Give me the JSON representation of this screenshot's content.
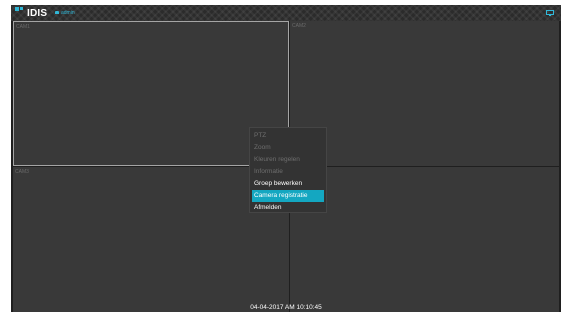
{
  "header": {
    "logo_text": "IDIS",
    "user": "admin",
    "icons": {
      "logo": "idis-logo",
      "user": "lock-icon",
      "monitor": "monitor-icon"
    }
  },
  "cameras": [
    {
      "label": "CAM1",
      "selected": true
    },
    {
      "label": "CAM2",
      "selected": false
    },
    {
      "label": "CAM3",
      "selected": false
    },
    {
      "label": "",
      "selected": false
    }
  ],
  "context_menu": {
    "items": [
      {
        "label": "PTZ",
        "enabled": false,
        "selected": false
      },
      {
        "label": "Zoom",
        "enabled": false,
        "selected": false
      },
      {
        "label": "Kleuren regelen",
        "enabled": false,
        "selected": false
      },
      {
        "label": "Informatie",
        "enabled": false,
        "selected": false
      },
      {
        "label": "Groep bewerken",
        "enabled": true,
        "selected": false
      },
      {
        "label": "Camera registratie",
        "enabled": true,
        "selected": true
      },
      {
        "label": "Afmelden",
        "enabled": true,
        "selected": false
      }
    ]
  },
  "status": {
    "datetime": "04-04-2017  AM 10:10:45"
  },
  "colors": {
    "accent": "#14a7c1",
    "background": "#1f1f1f",
    "cell": "#393939"
  }
}
